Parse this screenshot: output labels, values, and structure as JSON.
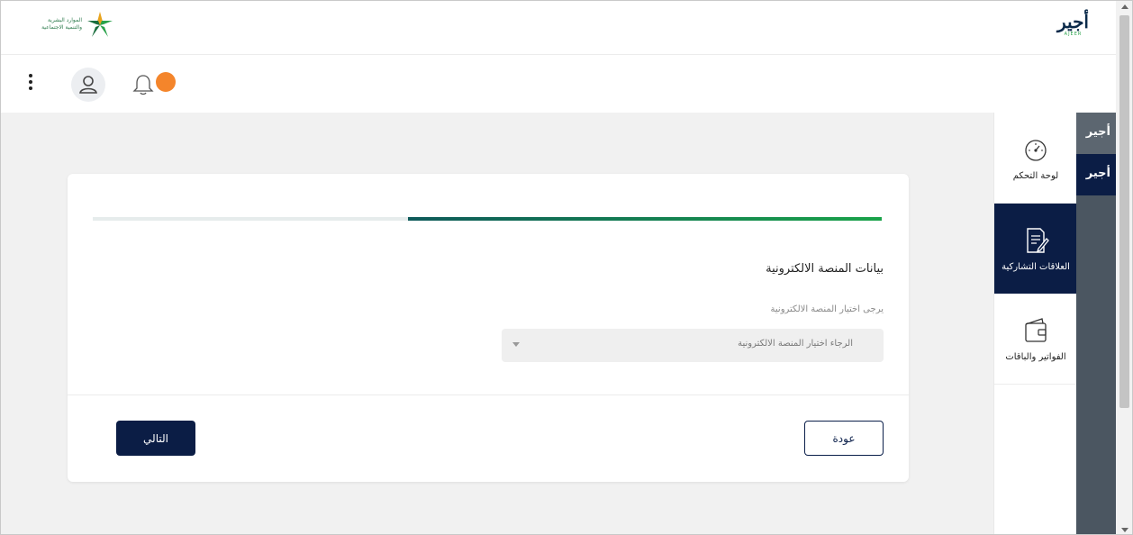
{
  "header": {
    "brand_text": [
      "الموارد البشرية",
      "والتنمية الاجتماعية"
    ],
    "ajeer_logo": "أجير",
    "ajeer_sub": "AJEER"
  },
  "card": {
    "progress_percent": 60,
    "section_title": "بيانات المنصة الالكترونية",
    "field_label": "يرجى اختيار المنصة الالكترونية",
    "select_placeholder": "الرجاء اختيار المنصة الالكترونية",
    "back_label": "عودة",
    "next_label": "التالي"
  },
  "sidebar": {
    "items": [
      {
        "label": "لوحة التحكم",
        "icon": "speedometer-icon",
        "active": false
      },
      {
        "label": "العلاقات التشاركية",
        "icon": "document-edit-icon",
        "active": true
      },
      {
        "label": "الفواتير والباقات",
        "icon": "wallet-icon",
        "active": false
      }
    ]
  },
  "rail": {
    "items": [
      "أجير",
      "أجير"
    ]
  },
  "colors": {
    "navy": "#0b1d45",
    "notification": "#f4852b",
    "rail": "#4b5661",
    "progress_start": "#0e5a5a",
    "progress_end": "#1aa34a"
  }
}
